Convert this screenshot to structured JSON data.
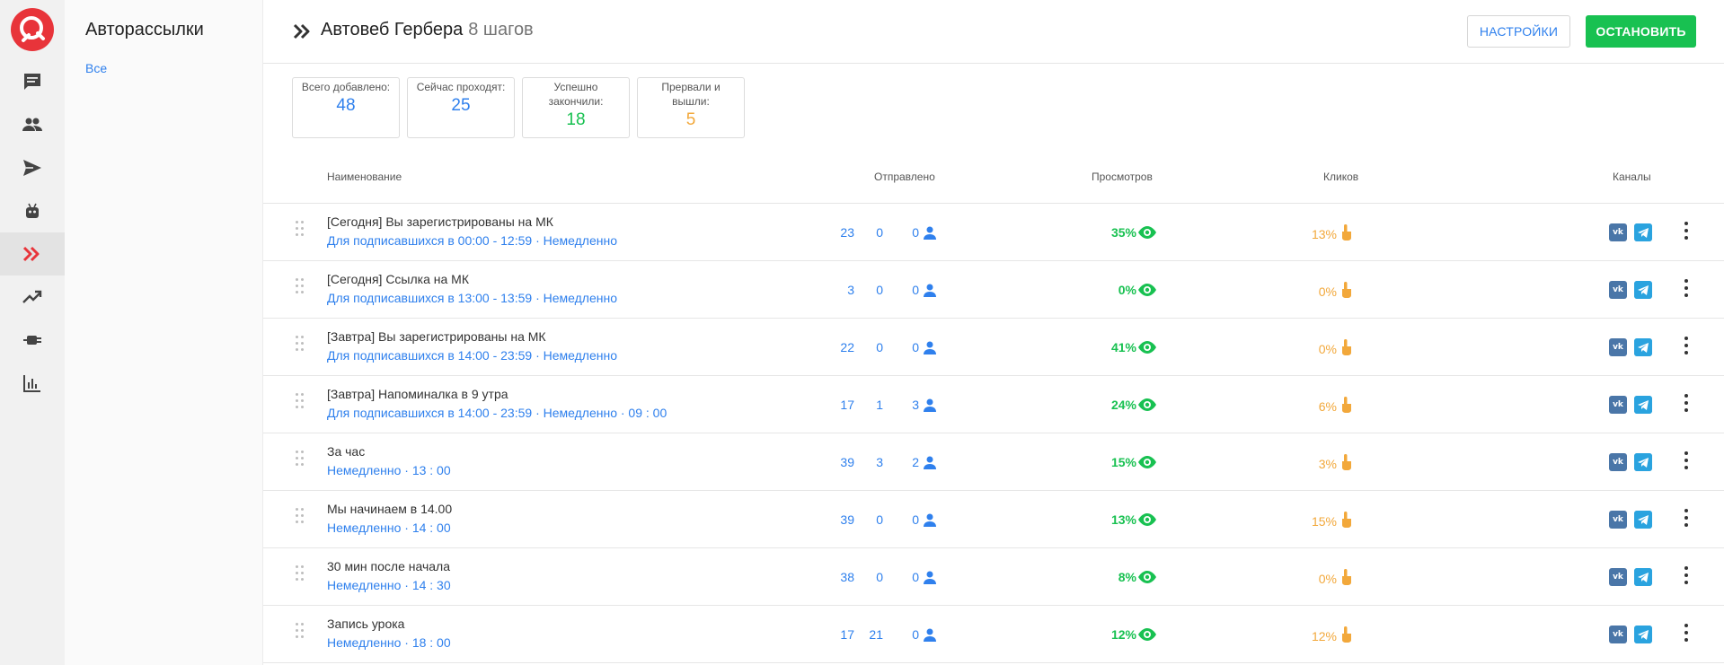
{
  "nav": {
    "items": [
      {
        "icon": "chat-icon"
      },
      {
        "icon": "users-icon"
      },
      {
        "icon": "send-icon"
      },
      {
        "icon": "bot-icon"
      },
      {
        "icon": "autoweb-icon",
        "active": true
      },
      {
        "icon": "trending-icon"
      },
      {
        "icon": "plug-icon"
      },
      {
        "icon": "bar-chart-icon"
      }
    ]
  },
  "sidebar": {
    "title": "Авторассылки",
    "link": "Все"
  },
  "header": {
    "title": "Автовеб Гербера",
    "steps": "8 шагов",
    "settings_label": "НАСТРОЙКИ",
    "stop_label": "ОСТАНОВИТЬ"
  },
  "stats": [
    {
      "label": "Всего добавлено:",
      "value": "48",
      "color": "#2f80ed"
    },
    {
      "label": "Сейчас проходят:",
      "value": "25",
      "color": "#2f80ed"
    },
    {
      "label": "Успешно закончили:",
      "value": "18",
      "color": "#18c151"
    },
    {
      "label": "Прервали и вышли:",
      "value": "5",
      "color": "#f2a83b"
    }
  ],
  "table": {
    "headers": {
      "name": "Наименование",
      "sent": "Отправлено",
      "views": "Просмотров",
      "clicks": "Кликов",
      "channels": "Каналы"
    },
    "rows": [
      {
        "name": "[Сегодня] Вы зарегистрированы на МК",
        "sub": "Для подписавшихся в 00:00 - 12:59 · Немедленно",
        "sent": [
          "23",
          "0",
          "0"
        ],
        "views": "35%",
        "clicks": "13%"
      },
      {
        "name": "[Сегодня] Ссылка на МК",
        "sub": "Для подписавшихся в 13:00 - 13:59 · Немедленно",
        "sent": [
          "3",
          "0",
          "0"
        ],
        "views": "0%",
        "clicks": "0%"
      },
      {
        "name": "[Завтра] Вы зарегистрированы на МК",
        "sub": "Для подписавшихся в 14:00 - 23:59 · Немедленно",
        "sent": [
          "22",
          "0",
          "0"
        ],
        "views": "41%",
        "clicks": "0%"
      },
      {
        "name": "[Завтра] Напоминалка в 9 утра",
        "sub": "Для подписавшихся в 14:00 - 23:59 · Немедленно · 09 : 00",
        "sent": [
          "17",
          "1",
          "3"
        ],
        "views": "24%",
        "clicks": "6%"
      },
      {
        "name": "За час",
        "sub": "Немедленно · 13 : 00",
        "sent": [
          "39",
          "3",
          "2"
        ],
        "views": "15%",
        "clicks": "3%"
      },
      {
        "name": "Мы начинаем в 14.00",
        "sub": "Немедленно · 14 : 00",
        "sent": [
          "39",
          "0",
          "0"
        ],
        "views": "13%",
        "clicks": "15%"
      },
      {
        "name": "30 мин после начала",
        "sub": "Немедленно · 14 : 30",
        "sent": [
          "38",
          "0",
          "0"
        ],
        "views": "8%",
        "clicks": "0%"
      },
      {
        "name": "Запись урока",
        "sub": "Немедленно · 18 : 00",
        "sent": [
          "17",
          "21",
          "0"
        ],
        "views": "12%",
        "clicks": "12%"
      }
    ]
  },
  "icons": {
    "vk_text": "vk"
  },
  "colors": {
    "accent": "#2f80ed",
    "green": "#18c151",
    "orange": "#f2a83b",
    "brand_red": "#e8343a"
  }
}
